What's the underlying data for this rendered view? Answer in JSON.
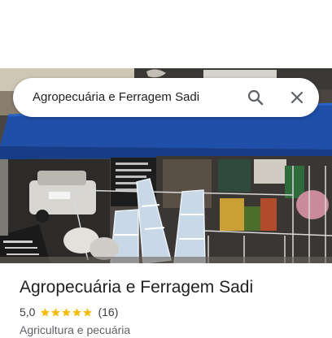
{
  "search": {
    "query": "Agropecuária e Ferragem Sadi"
  },
  "icons": {
    "search": "search-icon",
    "close": "close-icon",
    "star": "star-icon"
  },
  "place": {
    "name": "Agropecuária e Ferragem Sadi",
    "rating": "5,0",
    "stars": 5,
    "review_count": "(16)",
    "category": "Agricultura e pecuária"
  },
  "colors": {
    "star": "#fbbc04",
    "awning": "#1f4fa8",
    "icon": "#5f6368"
  }
}
